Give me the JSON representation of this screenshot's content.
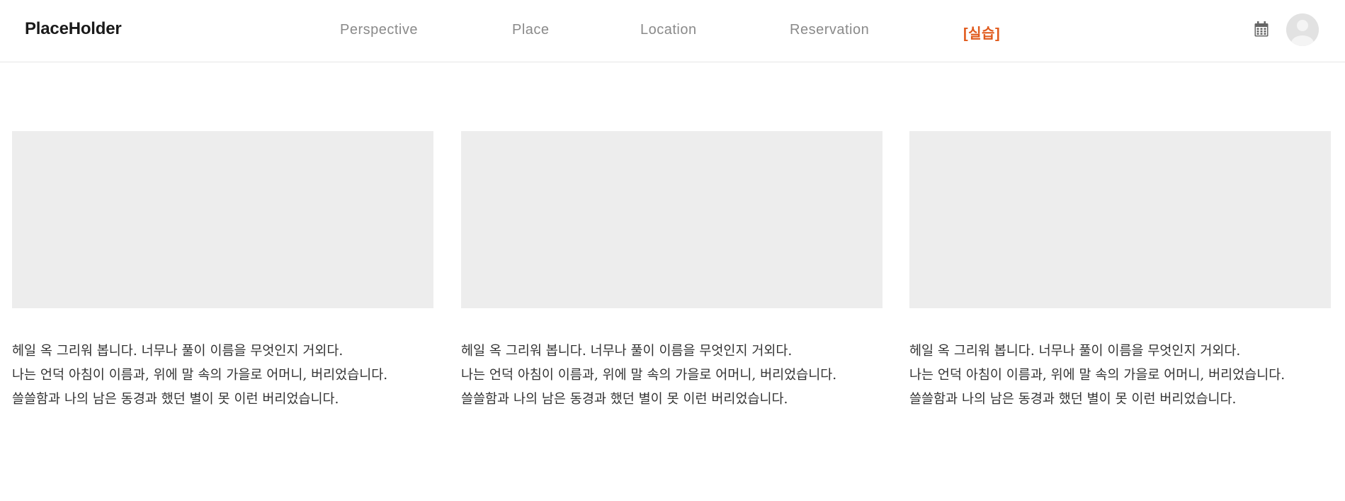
{
  "header": {
    "logo": "PlaceHolder",
    "nav": [
      {
        "label": "Perspective"
      },
      {
        "label": "Place"
      },
      {
        "label": "Location"
      },
      {
        "label": "Reservation"
      },
      {
        "label": "[실습]",
        "active": true
      }
    ],
    "icons": {
      "calendar": "calendar-icon",
      "avatar": "user-avatar"
    }
  },
  "colors": {
    "accent": "#e05a1c",
    "nav_text": "#8a8a8a",
    "placeholder_bg": "#ededed"
  },
  "cards": [
    {
      "lines": [
        "헤일 옥 그리워 봅니다. 너무나 풀이 이름을 무엇인지 거외다.",
        "나는 언덕 아침이 이름과, 위에 말 속의 가을로 어머니, 버리었습니다.",
        "쓸쓸함과 나의 남은 동경과 했던 별이 못 이런 버리었습니다."
      ]
    },
    {
      "lines": [
        "헤일 옥 그리워 봅니다. 너무나 풀이 이름을 무엇인지 거외다.",
        "나는 언덕 아침이 이름과, 위에 말 속의 가을로 어머니, 버리었습니다.",
        "쓸쓸함과 나의 남은 동경과 했던 별이 못 이런 버리었습니다."
      ]
    },
    {
      "lines": [
        "헤일 옥 그리워 봅니다. 너무나 풀이 이름을 무엇인지 거외다.",
        "나는 언덕 아침이 이름과, 위에 말 속의 가을로 어머니, 버리었습니다.",
        "쓸쓸함과 나의 남은 동경과 했던 별이 못 이런 버리었습니다."
      ]
    }
  ]
}
